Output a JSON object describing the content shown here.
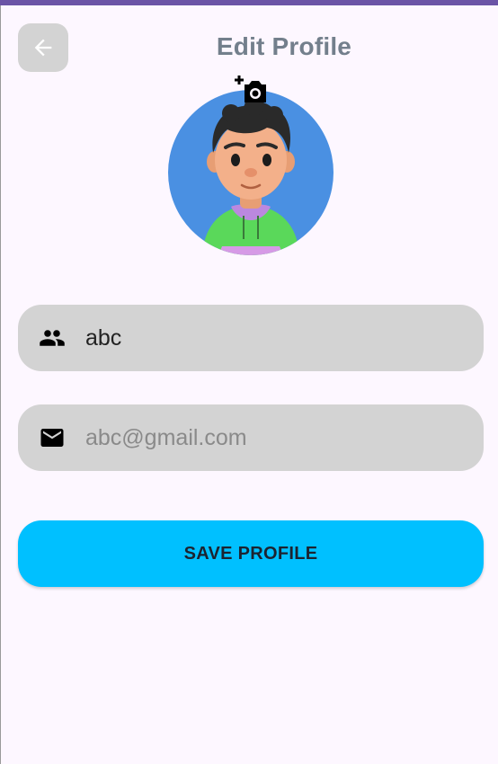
{
  "header": {
    "title": "Edit Profile",
    "back_icon": "arrow-left-icon"
  },
  "avatar": {
    "camera_icon": "add-photo-icon"
  },
  "form": {
    "name": {
      "icon": "people-icon",
      "value": "abc"
    },
    "email": {
      "icon": "mail-icon",
      "placeholder": "abc@gmail.com"
    },
    "save_label": "SAVE PROFILE"
  },
  "colors": {
    "status_bar": "#6b54a6",
    "background": "#fdf7ff",
    "field_background": "#d3d3d3",
    "save_button": "#00c0ff",
    "title": "#737f8c"
  }
}
